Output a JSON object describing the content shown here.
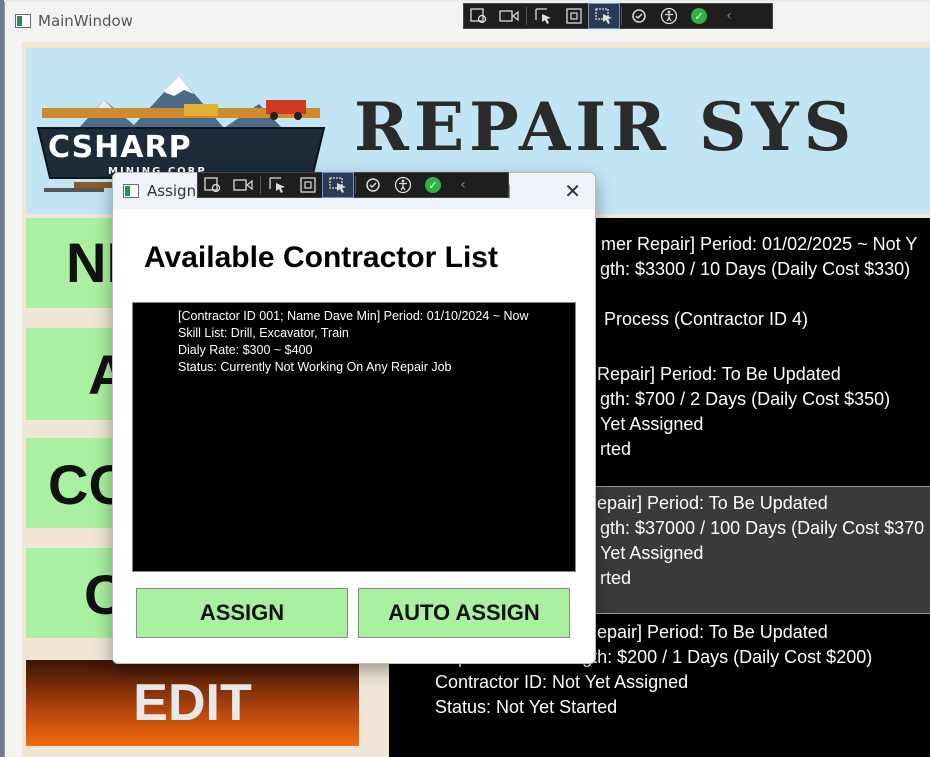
{
  "main_window": {
    "title": "MainWindow",
    "banner": {
      "logo_text": "CSHARP",
      "logo_subtext": "MINING CORP",
      "title": "REPAIR SYS"
    },
    "side_buttons": [
      "NE",
      "A",
      "CO",
      "C"
    ],
    "edit_button": "EDIT",
    "repair_list": [
      {
        "lines": [
          "mer Repair]  Period: 01/02/2025 ~ Not Y",
          "gth: $3300 / 10 Days (Daily Cost $330)",
          "Process (Contractor ID 4)"
        ]
      },
      {
        "lines": [
          "Repair]  Period: To Be Updated",
          "gth: $700 / 2 Days (Daily Cost $350)",
          "Yet Assigned",
          "rted"
        ]
      },
      {
        "lines": [
          "epair]  Period: To Be Updated",
          "gth: $37000 / 100 Days (Daily Cost $370",
          "Yet Assigned",
          "rted"
        ]
      },
      {
        "lines": [
          "epair]  Period: To Be Updated",
          "Repair Cost & Length: $200 / 1 Days (Daily Cost $200)",
          "Contractor ID: Not Yet Assigned",
          "Status: Not Yet Started"
        ]
      }
    ]
  },
  "dialog": {
    "title": "AssignW",
    "title_tail": "]",
    "close_glyph": "✕",
    "heading": "Available Contractor List",
    "contractor_lines": [
      "[Contractor ID 001; Name Dave Min]  Period: 01/10/2024 ~ Now",
      "Skill List: Drill, Excavator, Train",
      "Dialy Rate: $300 ~ $400",
      "Status: Currently Not Working On Any Repair Job"
    ],
    "assign_button": "ASSIGN",
    "auto_assign_button": "AUTO ASSIGN"
  },
  "debug_toolbar": {
    "icons": [
      "select-element-icon",
      "record-icon",
      "pointer-icon",
      "bounds-icon",
      "track-focus-icon",
      "hot-reload-icon",
      "accessibility-icon",
      "check-icon",
      "collapse-icon"
    ],
    "collapse_glyph": "‹"
  }
}
